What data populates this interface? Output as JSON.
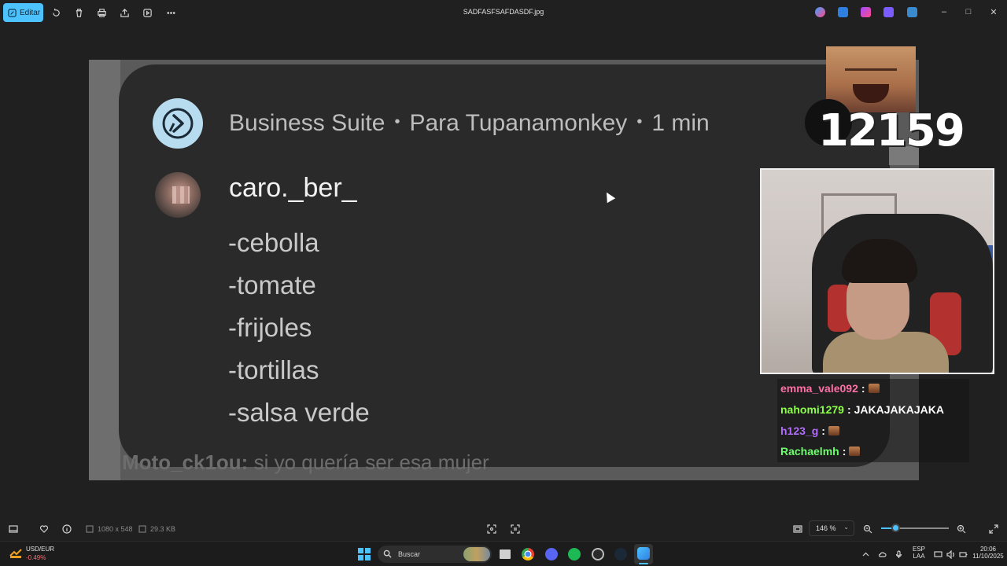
{
  "toolbar": {
    "edit_label": "Editar",
    "file_title": "SADFASFSAFDASDF.jpg"
  },
  "image": {
    "header": {
      "source": "Business Suite",
      "recipient": "Para Tupanamonkey",
      "time": "1 min",
      "separator": "•"
    },
    "comment": {
      "username": "caro._ber_",
      "items": [
        "-cebolla",
        "-tomate",
        "-frijoles",
        "-tortillas",
        "-salsa verde"
      ]
    },
    "ghost_line": {
      "user": "Moto_ck1ou:",
      "text": "si yo quería ser esa mujer"
    },
    "counter": "12159",
    "chat": [
      {
        "user": "emma_vale092",
        "color": "#ff6fa5",
        "message": ""
      },
      {
        "user": "nahomi1279",
        "color": "#8cff4a",
        "message": "JAKAJAKAJAKA"
      },
      {
        "user": "h123_g",
        "color": "#b36bff",
        "message": ""
      },
      {
        "user": "Rachaelmh",
        "color": "#6bff6b",
        "message": ""
      }
    ],
    "chat_separator": ":"
  },
  "statusbar": {
    "dimensions": "1080 x 548",
    "filesize": "29.3 KB",
    "zoom": "146 %",
    "zoom_slider_fraction": 0.2
  },
  "taskbar": {
    "currency_pair": "USD/EUR",
    "currency_change": "-0.49%",
    "search_placeholder": "Buscar",
    "lang_line1": "ESP",
    "lang_line2": "LAA",
    "time": "20:06",
    "date": "11/10/2025"
  },
  "colors": {
    "accent": "#4cc2ff",
    "card_bg": "#2a2a2a",
    "negative": "#ff6b6b"
  }
}
